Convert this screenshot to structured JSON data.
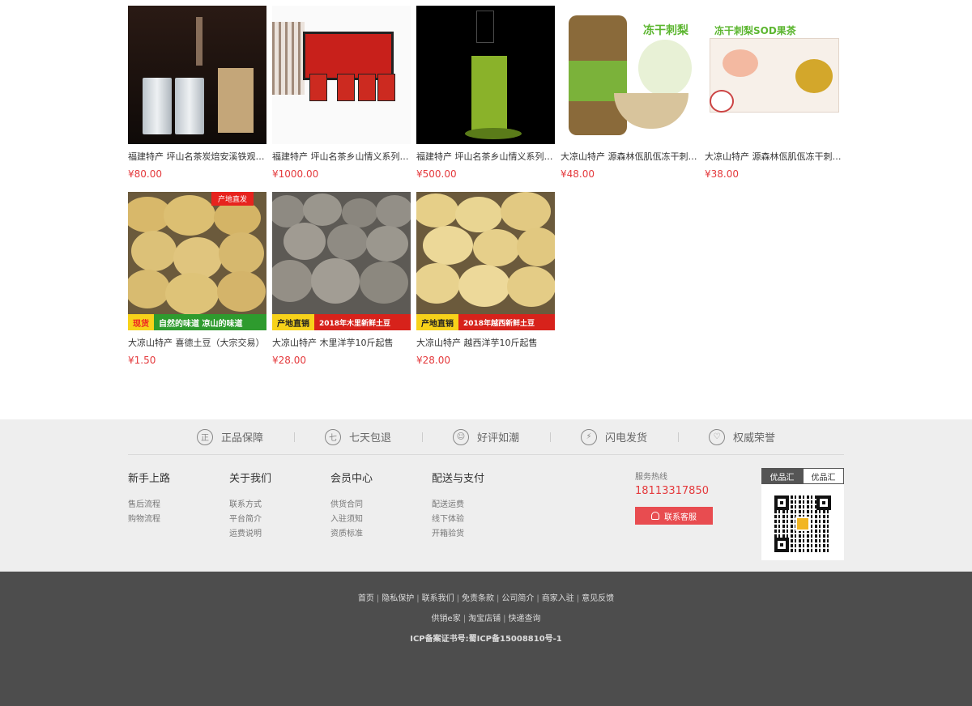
{
  "products": [
    {
      "name": "福建特产 坪山名茶炭焙安溪铁观音...",
      "price": "¥80.00"
    },
    {
      "name": "福建特产 坪山名茶乡山情义系列浓...",
      "price": "¥1000.00"
    },
    {
      "name": "福建特产 坪山名茶乡山情义系列浓...",
      "price": "¥500.00"
    },
    {
      "name": "大凉山特产 源森林佤肌佤冻干刺梨...",
      "price": "¥48.00"
    },
    {
      "name": "大凉山特产 源森林佤肌佤冻干刺梨...",
      "price": "¥38.00"
    },
    {
      "name": "大凉山特产 喜德土豆（大宗交易）",
      "price": "¥1.50"
    },
    {
      "name": "大凉山特产 木里洋芋10斤起售",
      "price": "¥28.00"
    },
    {
      "name": "大凉山特产 越西洋芋10斤起售",
      "price": "¥28.00"
    }
  ],
  "image_text": {
    "jar_title": "冻干刺梨",
    "box_title": "冻干刺梨SOD果茶",
    "p6_tag": "产地直发",
    "p6_banner_a": "现货",
    "p6_banner_b": "自然的味道 凉山的味道",
    "p7_banner_a": "产地直销",
    "p7_banner_b": "2018年木里新鲜土豆",
    "p8_banner_a": "产地直销",
    "p8_banner_b": "2018年越西新鲜土豆"
  },
  "services": [
    {
      "icon": "正",
      "label": "正品保障"
    },
    {
      "icon": "七",
      "label": "七天包退"
    },
    {
      "icon": "☺",
      "label": "好评如潮"
    },
    {
      "icon": "⚡",
      "label": "闪电发货"
    },
    {
      "icon": "♡",
      "label": "权威荣誉"
    }
  ],
  "footer_columns": [
    {
      "title": "新手上路",
      "links": [
        "售后流程",
        "购物流程"
      ]
    },
    {
      "title": "关于我们",
      "links": [
        "联系方式",
        "平台简介",
        "运费说明"
      ]
    },
    {
      "title": "会员中心",
      "links": [
        "供货合同",
        "入驻须知",
        "资质标准"
      ]
    },
    {
      "title": "配送与支付",
      "links": [
        "配送运费",
        "线下体验",
        "开箱验货"
      ]
    }
  ],
  "hotline": {
    "label": "服务热线",
    "number": "18113317850",
    "button": "联系客服"
  },
  "qr": {
    "tab_active": "优品汇",
    "tab_inactive": "优品汇"
  },
  "bottom_links": [
    "首页",
    "隐私保护",
    "联系我们",
    "免责条款",
    "公司简介",
    "商家入驻",
    "意见反馈"
  ],
  "bottom_links2": [
    "供销e家",
    "淘宝店铺",
    "快递查询"
  ],
  "icp": "ICP备案证书号:蜀ICP备15008810号-1",
  "colors": {
    "price": "#e4393c",
    "footer_light": "#eeeeee",
    "footer_dark": "#4d4d4d",
    "button": "#e84c50"
  }
}
